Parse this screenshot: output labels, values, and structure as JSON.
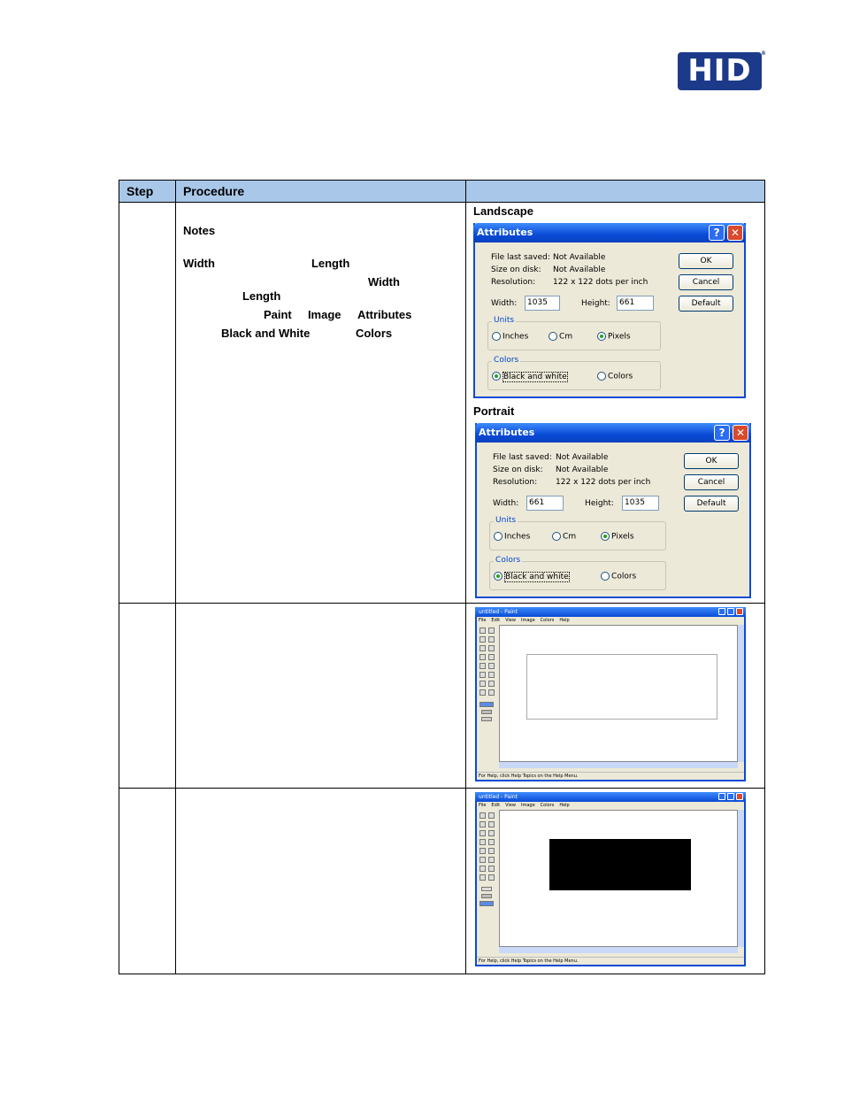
{
  "logo": {
    "text": "HID",
    "reg": "®"
  },
  "table": {
    "headers": [
      "Step",
      "Procedure",
      ""
    ],
    "row1": {
      "notes_label": "Notes",
      "terms": {
        "width": "Width",
        "length": "Length",
        "width2": "Width",
        "length2": "Length",
        "paint": "Paint",
        "image": "Image",
        "attributes": "Attributes",
        "bw": "Black and White",
        "colors": "Colors"
      },
      "landscape_caption": "Landscape",
      "portrait_caption": "Portrait"
    }
  },
  "dialogs": {
    "landscape": {
      "title": "Attributes",
      "file_last_saved_label": "File last saved:",
      "file_last_saved_value": "Not Available",
      "size_on_disk_label": "Size on disk:",
      "size_on_disk_value": "Not Available",
      "resolution_label": "Resolution:",
      "resolution_value": "122 x 122 dots per inch",
      "width_label": "Width:",
      "width_value": "1035",
      "height_label": "Height:",
      "height_value": "661",
      "units_label": "Units",
      "inches": "Inches",
      "cm": "Cm",
      "pixels": "Pixels",
      "colors_label": "Colors",
      "bw": "Black and white",
      "colors": "Colors",
      "ok": "OK",
      "cancel": "Cancel",
      "default": "Default"
    },
    "portrait": {
      "title": "Attributes",
      "file_last_saved_label": "File last saved:",
      "file_last_saved_value": "Not Available",
      "size_on_disk_label": "Size on disk:",
      "size_on_disk_value": "Not Available",
      "resolution_label": "Resolution:",
      "resolution_value": "122 x 122 dots per inch",
      "width_label": "Width:",
      "width_value": "661",
      "height_label": "Height:",
      "height_value": "1035",
      "units_label": "Units",
      "inches": "Inches",
      "cm": "Cm",
      "pixels": "Pixels",
      "colors_label": "Colors",
      "bw": "Black and white",
      "colors": "Colors",
      "ok": "OK",
      "cancel": "Cancel",
      "default": "Default"
    }
  },
  "paint": {
    "title": "untitled - Paint",
    "menu": [
      "File",
      "Edit",
      "View",
      "Image",
      "Colors",
      "Help"
    ],
    "status": "For Help, click Help Topics on the Help Menu."
  }
}
